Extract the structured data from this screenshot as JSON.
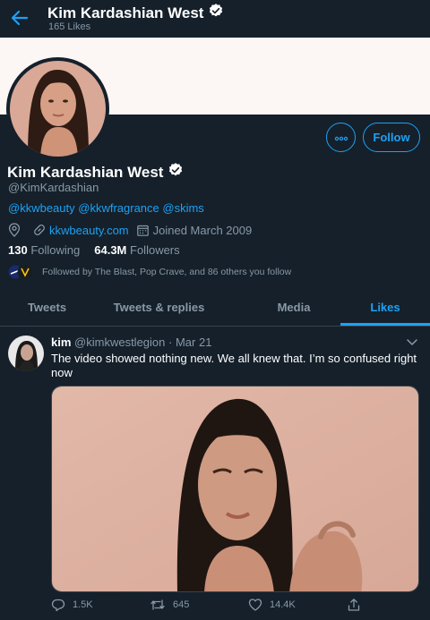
{
  "header": {
    "title": "Kim Kardashian West",
    "subtitle": "165 Likes"
  },
  "profile": {
    "name": "Kim Kardashian West",
    "handle": "@KimKardashian",
    "bio_links": [
      "@kkwbeauty",
      "@kkwfragrance",
      "@skims"
    ],
    "website": "kkwbeauty.com",
    "joined": "Joined March 2009",
    "following_count": "130",
    "following_label": "Following",
    "followers_count": "64.3M",
    "followers_label": "Followers",
    "followed_by": "Followed by The Blast, Pop Crave, and 86 others you follow",
    "follow_button": "Follow"
  },
  "tabs": [
    {
      "label": "Tweets",
      "active": false
    },
    {
      "label": "Tweets & replies",
      "active": false
    },
    {
      "label": "Media",
      "active": false
    },
    {
      "label": "Likes",
      "active": true
    }
  ],
  "tweet": {
    "name": "kim",
    "handle": "@kimkwestlegion",
    "separator": "·",
    "date": "Mar 21",
    "text": "The video showed nothing new. We all knew that. I’m so confused right now",
    "replies": "1.5K",
    "retweets": "645",
    "likes": "14.4K"
  },
  "colors": {
    "background": "#15202b",
    "accent": "#1da1f2",
    "secondary_text": "#8899a6",
    "divider": "#38444d",
    "banner": "#fcf6f5"
  },
  "icons": [
    "back-arrow-icon",
    "verified-badge-icon",
    "more-options-icon",
    "location-icon",
    "link-icon",
    "calendar-icon",
    "chevron-down-icon",
    "reply-icon",
    "retweet-icon",
    "like-icon",
    "share-icon"
  ]
}
